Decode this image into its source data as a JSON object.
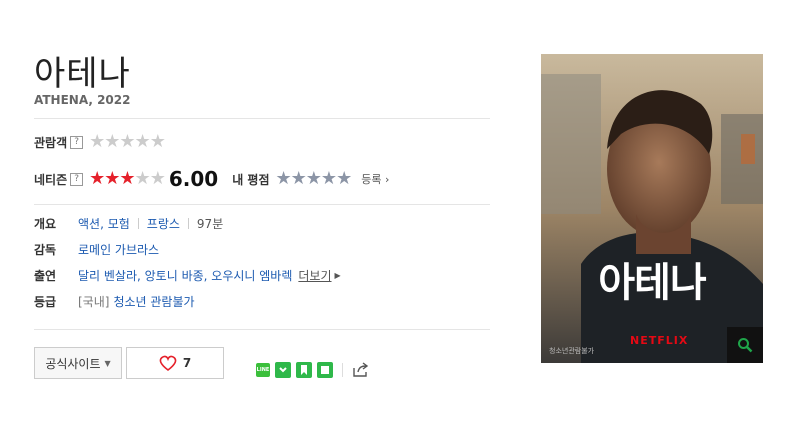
{
  "movie": {
    "title": "아테나",
    "subtitle": "ATHENA, 2022"
  },
  "ratings": {
    "audience_label": "관람객",
    "audience_help": "?",
    "audience_stars": 0,
    "netizen_label": "네티즌",
    "netizen_help": "?",
    "netizen_stars": 3,
    "netizen_score": "6.00",
    "my_rating_label": "내 평점",
    "my_rating_stars": 0,
    "register_label": "등록"
  },
  "info": {
    "overview_label": "개요",
    "genre": "액션, 모험",
    "country": "프랑스",
    "runtime": "97분",
    "director_label": "감독",
    "director": "로메인 가브라스",
    "cast_label": "출연",
    "cast": "달리 벤살라, 앙토니 바종, 오우시니 엠바렉",
    "more_label": "더보기",
    "grade_label": "등급",
    "grade_prefix": "[국내]",
    "grade": "청소년 관람불가"
  },
  "actions": {
    "official_site_label": "공식사이트",
    "like_count": "7"
  },
  "poster": {
    "title_text": "아테나",
    "brand_text": "NETFLIX",
    "rating_mark": "청소년관람불가",
    "colors": {
      "sky": "#bfa98a",
      "jacket": "#1e2226",
      "accent_green": "#1fa54a"
    }
  },
  "share": {
    "icons": [
      "line-icon",
      "band-icon",
      "bookmark-icon",
      "memo-icon",
      "share-icon"
    ],
    "line_text": "LINE"
  }
}
